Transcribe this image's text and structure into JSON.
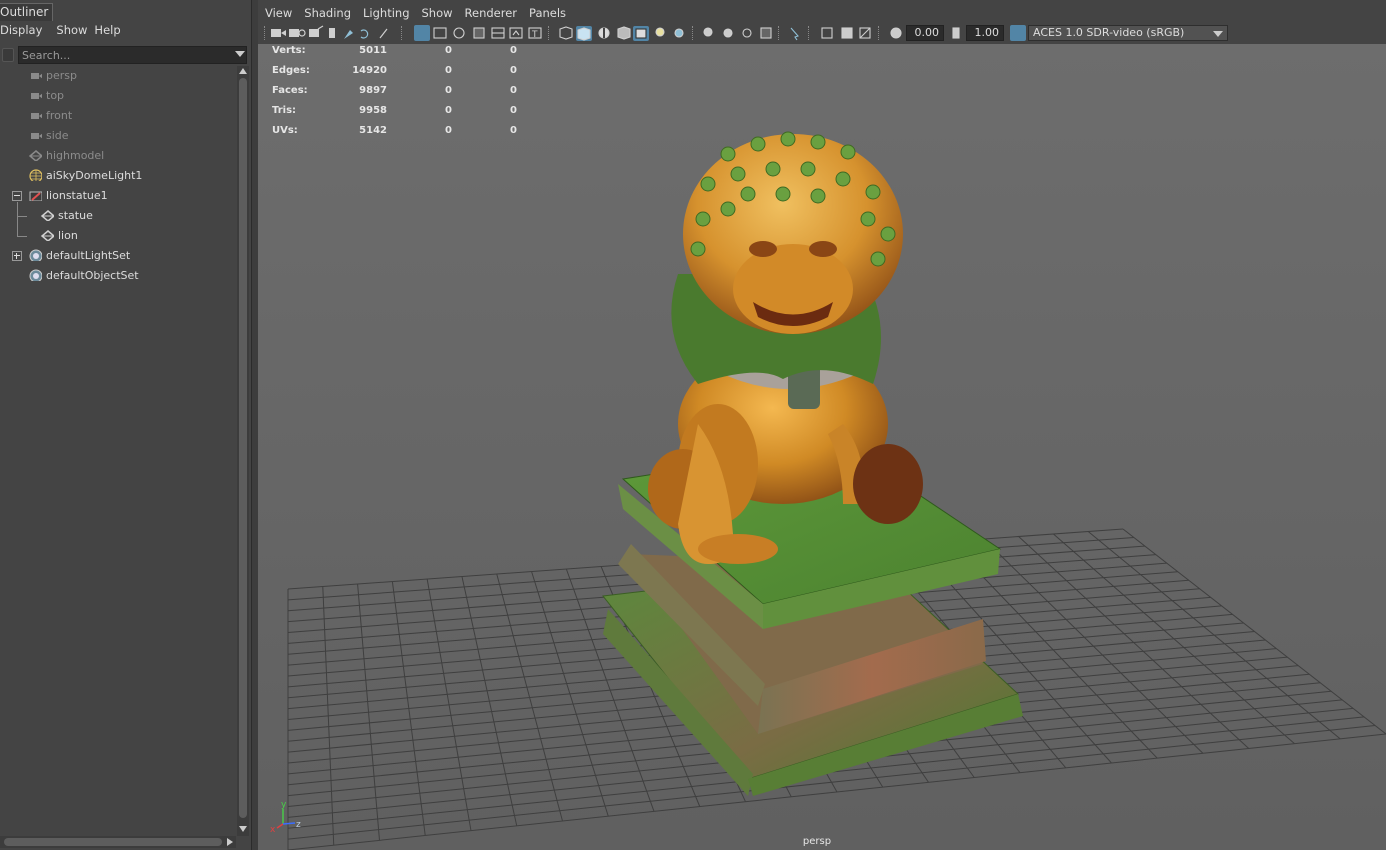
{
  "outliner": {
    "title": "Outliner",
    "menu": [
      "Display",
      "Show",
      "Help"
    ],
    "search_placeholder": "Search...",
    "items": [
      {
        "label": "persp",
        "icon": "camera-icon",
        "dim": true
      },
      {
        "label": "top",
        "icon": "camera-icon",
        "dim": true
      },
      {
        "label": "front",
        "icon": "camera-icon",
        "dim": true
      },
      {
        "label": "side",
        "icon": "camera-icon",
        "dim": true
      },
      {
        "label": "highmodel",
        "icon": "mesh-icon",
        "dim": true
      },
      {
        "label": "aiSkyDomeLight1",
        "icon": "skydome-light-icon",
        "dim": false
      },
      {
        "label": "lionstatue1",
        "icon": "group-icon",
        "dim": false
      },
      {
        "label": "statue",
        "icon": "mesh-icon",
        "dim": false
      },
      {
        "label": "lion",
        "icon": "mesh-icon",
        "dim": false
      },
      {
        "label": "defaultLightSet",
        "icon": "set-icon",
        "dim": false
      },
      {
        "label": "defaultObjectSet",
        "icon": "set-icon",
        "dim": false
      }
    ]
  },
  "viewport": {
    "menu": [
      "View",
      "Shading",
      "Lighting",
      "Show",
      "Renderer",
      "Panels"
    ],
    "exposure": "0.00",
    "gamma": "1.00",
    "color_space": "ACES 1.0 SDR-video (sRGB)",
    "camera_name": "persp",
    "hud": [
      {
        "label": "Verts:",
        "v1": "5011",
        "v2": "0",
        "v3": "0"
      },
      {
        "label": "Edges:",
        "v1": "14920",
        "v2": "0",
        "v3": "0"
      },
      {
        "label": "Faces:",
        "v1": "9897",
        "v2": "0",
        "v3": "0"
      },
      {
        "label": "Tris:",
        "v1": "9958",
        "v2": "0",
        "v3": "0"
      },
      {
        "label": "UVs:",
        "v1": "5142",
        "v2": "0",
        "v3": "0"
      }
    ],
    "axis": {
      "x": "x",
      "y": "y",
      "z": "z"
    }
  },
  "colors": {
    "accent": "#5285a6",
    "viewport_bg": "#6a6a6a",
    "panel_bg": "#444444"
  }
}
